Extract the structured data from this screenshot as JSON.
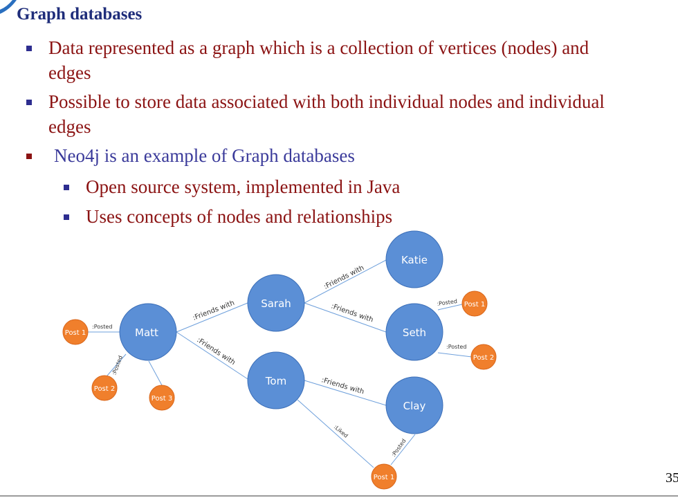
{
  "title": "Graph databases",
  "bullets": [
    {
      "line1": "Data represented as a graph which is a collection of vertices (nodes) and",
      "line2": "edges"
    },
    {
      "line1": "Possible to store data associated with both individual nodes and individual",
      "line2": "edges"
    },
    {
      "line1": "Neo4j is an example of Graph databases"
    }
  ],
  "sub_bullets": [
    "Open source system, implemented in Java",
    "Uses concepts of nodes and relationships"
  ],
  "graph": {
    "nodes": {
      "matt": "Matt",
      "sarah": "Sarah",
      "tom": "Tom",
      "katie": "Katie",
      "seth": "Seth",
      "clay": "Clay",
      "matt_post1": "Post 1",
      "matt_post2": "Post 2",
      "matt_post3": "Post 3",
      "seth_post1": "Post 1",
      "seth_post2": "Post 2",
      "bottom_post1": "Post 1"
    },
    "relationships": {
      "matt_sarah": ":Friends with",
      "matt_tom": ":Friends with",
      "sarah_katie": ":Friends with",
      "sarah_seth": ":Friends with",
      "tom_clay": ":Friends with",
      "tom_post": ":Liked",
      "matt_post1": ":Posted",
      "matt_post2": ":Posted",
      "seth_post1": ":Posted",
      "seth_post2": ":Posted",
      "clay_post": ":Posted"
    },
    "colors": {
      "person_node": "#5b8fd6",
      "post_node": "#f07f2c",
      "edge": "#6d9fdb"
    }
  },
  "page_number": "35"
}
